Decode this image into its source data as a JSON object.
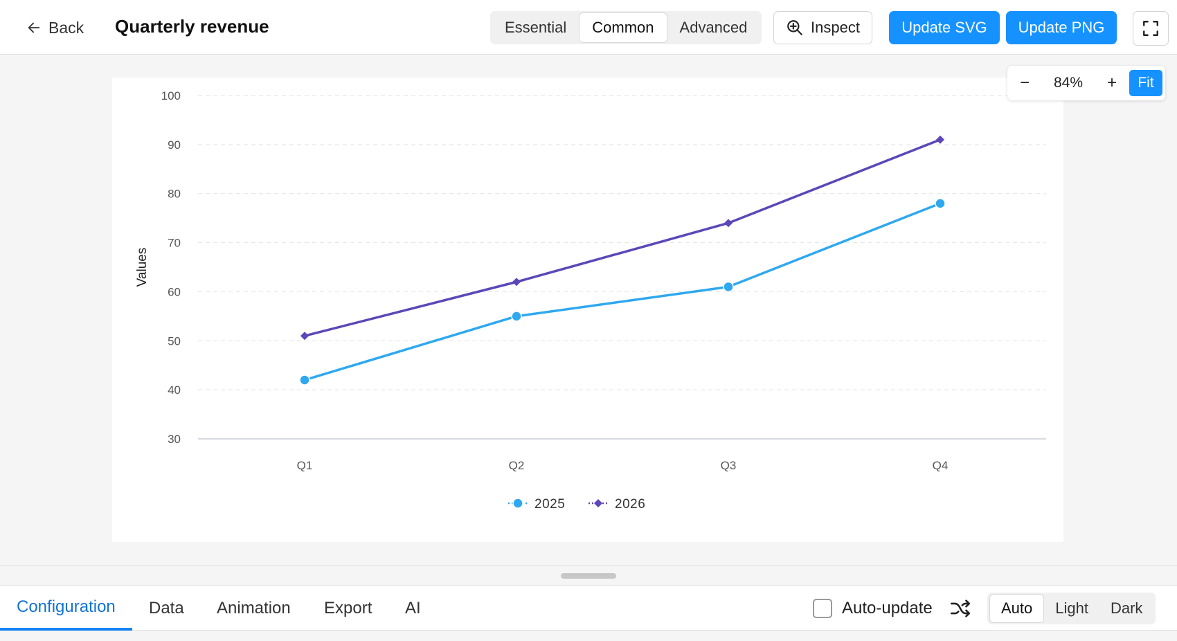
{
  "header": {
    "back_label": "Back",
    "title": "Quarterly revenue",
    "detail_levels": [
      "Essential",
      "Common",
      "Advanced"
    ],
    "active_detail_level": "Common",
    "inspect_label": "Inspect",
    "update_svg_label": "Update SVG",
    "update_png_label": "Update PNG"
  },
  "zoom": {
    "minus": "−",
    "value": "84%",
    "plus": "+",
    "fit_label": "Fit"
  },
  "chart_data": {
    "type": "line",
    "categories": [
      "Q1",
      "Q2",
      "Q3",
      "Q4"
    ],
    "series": [
      {
        "name": "2025",
        "values": [
          42,
          55,
          61,
          78
        ],
        "color": "#2fa8ef",
        "marker": "circle"
      },
      {
        "name": "2026",
        "values": [
          51,
          62,
          74,
          91
        ],
        "color": "#5b47b8",
        "marker": "diamond"
      }
    ],
    "ylabel": "Values",
    "ylim": [
      30,
      100
    ],
    "yticks": [
      30,
      40,
      50,
      60,
      70,
      80,
      90,
      100
    ],
    "grid": true,
    "legend_position": "bottom"
  },
  "bottom": {
    "tabs": [
      "Configuration",
      "Data",
      "Animation",
      "Export",
      "AI"
    ],
    "active_tab": "Configuration",
    "auto_update_label": "Auto-update",
    "auto_update_checked": false,
    "themes": [
      "Auto",
      "Light",
      "Dark"
    ],
    "active_theme": "Auto"
  },
  "colors": {
    "primary": "#1592ff",
    "active_tab": "#1273d6"
  },
  "icons": {
    "back": "arrow-left-icon",
    "inspect": "zoom-in-icon",
    "fullscreen": "fullscreen-icon",
    "shuffle": "shuffle-icon"
  }
}
